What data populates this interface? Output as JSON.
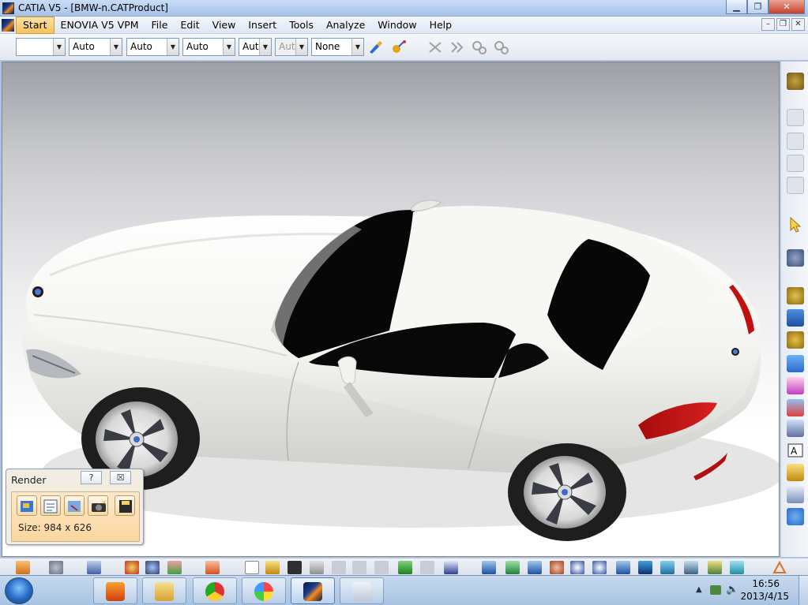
{
  "window": {
    "title": "CATIA V5 - [BMW-n.CATProduct]",
    "minimize": "▁",
    "restore": "❐",
    "close": "✕"
  },
  "menubar": {
    "items": [
      "Start",
      "ENOVIA V5 VPM",
      "File",
      "Edit",
      "View",
      "Insert",
      "Tools",
      "Analyze",
      "Window",
      "Help"
    ],
    "doc_minimize": "–",
    "doc_restore": "❐",
    "doc_close": "✕"
  },
  "toolbar": {
    "combos": [
      "",
      "Auto",
      "Auto",
      "Auto",
      "Aut",
      "Aut",
      "None"
    ]
  },
  "render_panel": {
    "title": "Render",
    "help": "?",
    "close": "☒",
    "size_label": "Size: 984 x 626"
  },
  "taskbar": {
    "time": "16:56",
    "date": "2013/4/15"
  },
  "icons": {
    "app": "catia-logo-icon",
    "render_buttons": [
      "render-shooting-icon",
      "render-settings-icon",
      "render-quick-icon",
      "render-camera-icon",
      "render-save-icon"
    ]
  }
}
